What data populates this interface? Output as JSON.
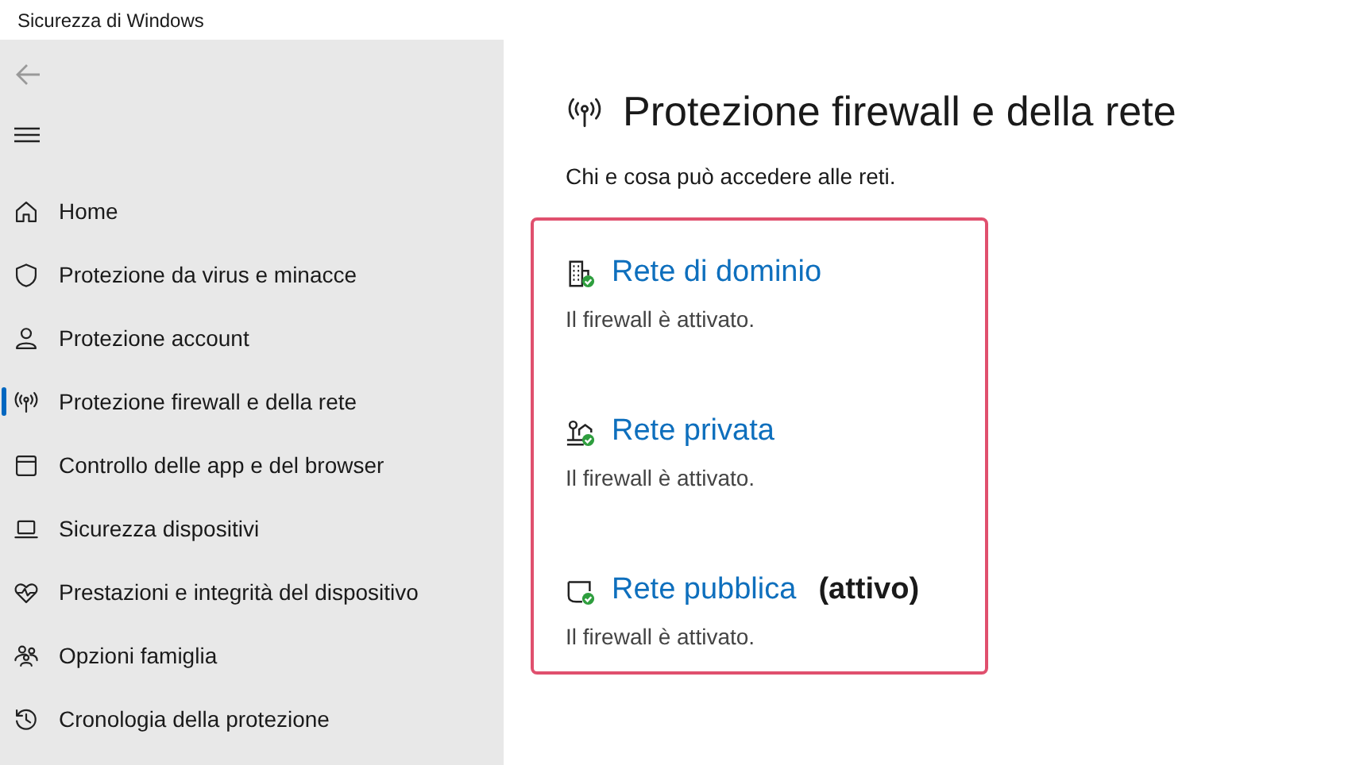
{
  "window": {
    "title": "Sicurezza di Windows"
  },
  "sidebar": {
    "items": [
      {
        "kind": "home",
        "label": "Home",
        "selected": false
      },
      {
        "kind": "shield",
        "label": "Protezione da virus e minacce",
        "selected": false
      },
      {
        "kind": "person",
        "label": "Protezione account",
        "selected": false
      },
      {
        "kind": "antenna",
        "label": "Protezione firewall e della rete",
        "selected": true
      },
      {
        "kind": "window",
        "label": "Controllo delle app e del browser",
        "selected": false
      },
      {
        "kind": "laptop",
        "label": "Sicurezza dispositivi",
        "selected": false
      },
      {
        "kind": "heart",
        "label": "Prestazioni e integrità del dispositivo",
        "selected": false
      },
      {
        "kind": "family",
        "label": "Opzioni famiglia",
        "selected": false
      },
      {
        "kind": "history",
        "label": "Cronologia della protezione",
        "selected": false
      }
    ]
  },
  "page": {
    "title": "Protezione firewall e della rete",
    "subtitle": "Chi e cosa può accedere alle reti.",
    "networks": [
      {
        "kind": "domain",
        "name": "Rete di dominio",
        "status": "Il firewall è attivato."
      },
      {
        "kind": "private",
        "name": "Rete privata",
        "status": "Il firewall è attivato."
      },
      {
        "kind": "public",
        "name": "Rete pubblica",
        "note": "(attivo)",
        "status": "Il firewall è attivato."
      }
    ]
  }
}
